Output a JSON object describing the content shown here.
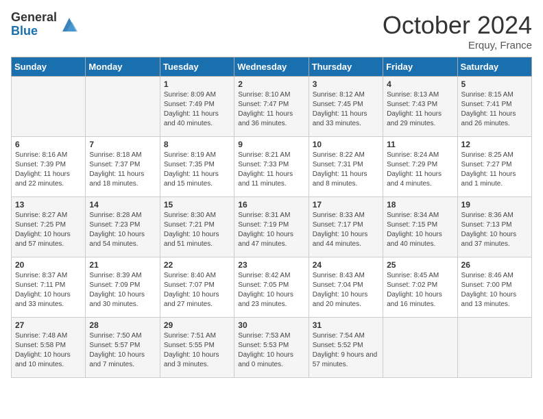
{
  "header": {
    "logo_general": "General",
    "logo_blue": "Blue",
    "month_title": "October 2024",
    "location": "Erquy, France"
  },
  "days_of_week": [
    "Sunday",
    "Monday",
    "Tuesday",
    "Wednesday",
    "Thursday",
    "Friday",
    "Saturday"
  ],
  "weeks": [
    [
      {
        "day": "",
        "info": ""
      },
      {
        "day": "",
        "info": ""
      },
      {
        "day": "1",
        "info": "Sunrise: 8:09 AM\nSunset: 7:49 PM\nDaylight: 11 hours and 40 minutes."
      },
      {
        "day": "2",
        "info": "Sunrise: 8:10 AM\nSunset: 7:47 PM\nDaylight: 11 hours and 36 minutes."
      },
      {
        "day": "3",
        "info": "Sunrise: 8:12 AM\nSunset: 7:45 PM\nDaylight: 11 hours and 33 minutes."
      },
      {
        "day": "4",
        "info": "Sunrise: 8:13 AM\nSunset: 7:43 PM\nDaylight: 11 hours and 29 minutes."
      },
      {
        "day": "5",
        "info": "Sunrise: 8:15 AM\nSunset: 7:41 PM\nDaylight: 11 hours and 26 minutes."
      }
    ],
    [
      {
        "day": "6",
        "info": "Sunrise: 8:16 AM\nSunset: 7:39 PM\nDaylight: 11 hours and 22 minutes."
      },
      {
        "day": "7",
        "info": "Sunrise: 8:18 AM\nSunset: 7:37 PM\nDaylight: 11 hours and 18 minutes."
      },
      {
        "day": "8",
        "info": "Sunrise: 8:19 AM\nSunset: 7:35 PM\nDaylight: 11 hours and 15 minutes."
      },
      {
        "day": "9",
        "info": "Sunrise: 8:21 AM\nSunset: 7:33 PM\nDaylight: 11 hours and 11 minutes."
      },
      {
        "day": "10",
        "info": "Sunrise: 8:22 AM\nSunset: 7:31 PM\nDaylight: 11 hours and 8 minutes."
      },
      {
        "day": "11",
        "info": "Sunrise: 8:24 AM\nSunset: 7:29 PM\nDaylight: 11 hours and 4 minutes."
      },
      {
        "day": "12",
        "info": "Sunrise: 8:25 AM\nSunset: 7:27 PM\nDaylight: 11 hours and 1 minute."
      }
    ],
    [
      {
        "day": "13",
        "info": "Sunrise: 8:27 AM\nSunset: 7:25 PM\nDaylight: 10 hours and 57 minutes."
      },
      {
        "day": "14",
        "info": "Sunrise: 8:28 AM\nSunset: 7:23 PM\nDaylight: 10 hours and 54 minutes."
      },
      {
        "day": "15",
        "info": "Sunrise: 8:30 AM\nSunset: 7:21 PM\nDaylight: 10 hours and 51 minutes."
      },
      {
        "day": "16",
        "info": "Sunrise: 8:31 AM\nSunset: 7:19 PM\nDaylight: 10 hours and 47 minutes."
      },
      {
        "day": "17",
        "info": "Sunrise: 8:33 AM\nSunset: 7:17 PM\nDaylight: 10 hours and 44 minutes."
      },
      {
        "day": "18",
        "info": "Sunrise: 8:34 AM\nSunset: 7:15 PM\nDaylight: 10 hours and 40 minutes."
      },
      {
        "day": "19",
        "info": "Sunrise: 8:36 AM\nSunset: 7:13 PM\nDaylight: 10 hours and 37 minutes."
      }
    ],
    [
      {
        "day": "20",
        "info": "Sunrise: 8:37 AM\nSunset: 7:11 PM\nDaylight: 10 hours and 33 minutes."
      },
      {
        "day": "21",
        "info": "Sunrise: 8:39 AM\nSunset: 7:09 PM\nDaylight: 10 hours and 30 minutes."
      },
      {
        "day": "22",
        "info": "Sunrise: 8:40 AM\nSunset: 7:07 PM\nDaylight: 10 hours and 27 minutes."
      },
      {
        "day": "23",
        "info": "Sunrise: 8:42 AM\nSunset: 7:05 PM\nDaylight: 10 hours and 23 minutes."
      },
      {
        "day": "24",
        "info": "Sunrise: 8:43 AM\nSunset: 7:04 PM\nDaylight: 10 hours and 20 minutes."
      },
      {
        "day": "25",
        "info": "Sunrise: 8:45 AM\nSunset: 7:02 PM\nDaylight: 10 hours and 16 minutes."
      },
      {
        "day": "26",
        "info": "Sunrise: 8:46 AM\nSunset: 7:00 PM\nDaylight: 10 hours and 13 minutes."
      }
    ],
    [
      {
        "day": "27",
        "info": "Sunrise: 7:48 AM\nSunset: 5:58 PM\nDaylight: 10 hours and 10 minutes."
      },
      {
        "day": "28",
        "info": "Sunrise: 7:50 AM\nSunset: 5:57 PM\nDaylight: 10 hours and 7 minutes."
      },
      {
        "day": "29",
        "info": "Sunrise: 7:51 AM\nSunset: 5:55 PM\nDaylight: 10 hours and 3 minutes."
      },
      {
        "day": "30",
        "info": "Sunrise: 7:53 AM\nSunset: 5:53 PM\nDaylight: 10 hours and 0 minutes."
      },
      {
        "day": "31",
        "info": "Sunrise: 7:54 AM\nSunset: 5:52 PM\nDaylight: 9 hours and 57 minutes."
      },
      {
        "day": "",
        "info": ""
      },
      {
        "day": "",
        "info": ""
      }
    ]
  ]
}
